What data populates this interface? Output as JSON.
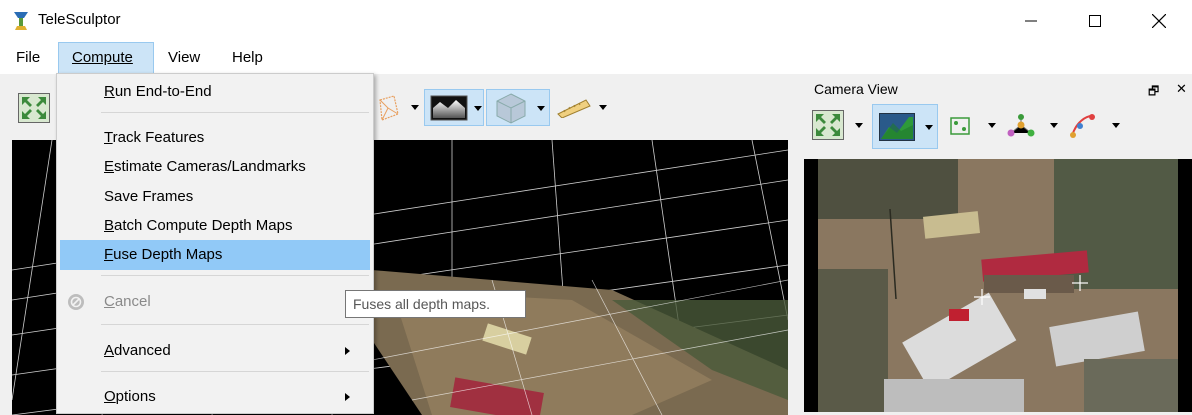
{
  "window": {
    "title": "TeleSculptor",
    "minimize_glyph": "—",
    "maximize_glyph": "☐",
    "close_glyph": "✕"
  },
  "menubar": {
    "items": [
      {
        "label": "File"
      },
      {
        "label": "Compute",
        "active": true
      },
      {
        "label": "View"
      },
      {
        "label": "Help"
      }
    ]
  },
  "toolbar": {
    "icons": [
      "reset-view-icon",
      "camera-frustum-icon",
      "depth-map-icon",
      "volume-cube-icon",
      "measure-ruler-icon"
    ]
  },
  "camera_view": {
    "title": "Camera View",
    "float_glyph": "🗗",
    "close_glyph": "✕",
    "toolbar_icons": [
      "reset-view-icon",
      "image-icon",
      "feature-points-icon",
      "landmarks-icon",
      "residuals-icon"
    ]
  },
  "compute_menu": {
    "items": [
      {
        "label": "Run End-to-End",
        "mnemonic": "R",
        "rest": "un End-to-End"
      },
      {
        "label": "Track Features",
        "mnemonic": "T",
        "rest": "rack Features"
      },
      {
        "label": "Estimate Cameras/Landmarks",
        "mnemonic": "E",
        "rest": "stimate Cameras/Landmarks"
      },
      {
        "label": "Save Frames",
        "mnemonic": "",
        "rest": "Save Frames"
      },
      {
        "label": "Batch Compute Depth Maps",
        "mnemonic": "B",
        "rest": "atch Compute Depth Maps"
      },
      {
        "label": "Fuse Depth Maps",
        "mnemonic": "F",
        "rest": "use Depth Maps",
        "highlighted": true
      },
      {
        "label": "Cancel",
        "mnemonic": "C",
        "rest": "ancel",
        "disabled": true,
        "icon": "cancel-icon"
      },
      {
        "label": "Advanced",
        "mnemonic": "A",
        "rest": "dvanced",
        "submenu": true
      },
      {
        "label": "Options",
        "mnemonic": "O",
        "rest": "ptions",
        "submenu": true
      }
    ]
  },
  "tooltip": {
    "text": "Fuses all depth maps."
  },
  "colors": {
    "menu_highlight": "#91c9f7",
    "menubar_active": "#cce4f7",
    "accent_border": "#99c9ef"
  }
}
